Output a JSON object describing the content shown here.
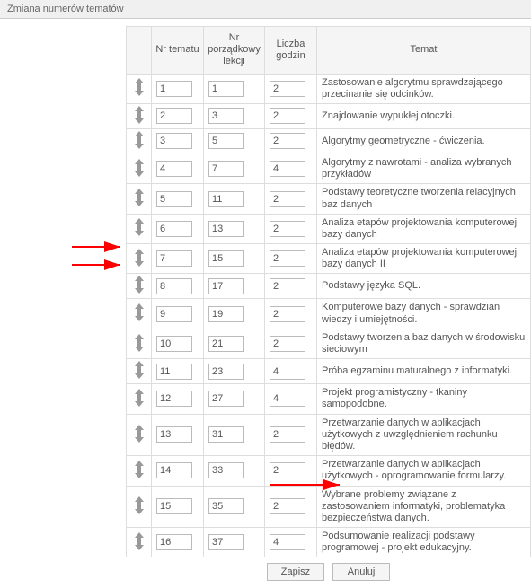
{
  "title": "Zmiana numerów tematów",
  "headers": {
    "nr_tematu": "Nr tematu",
    "nr_lekcji": "Nr porządkowy lekcji",
    "liczba_godzin": "Liczba godzin",
    "temat": "Temat"
  },
  "rows": [
    {
      "nr": "1",
      "lp": "1",
      "lg": "2",
      "topic": "Zastosowanie algorytmu sprawdzającego przecinanie się odcinków."
    },
    {
      "nr": "2",
      "lp": "3",
      "lg": "2",
      "topic": "Znajdowanie wypukłej otoczki."
    },
    {
      "nr": "3",
      "lp": "5",
      "lg": "2",
      "topic": "Algorytmy geometryczne - ćwiczenia."
    },
    {
      "nr": "4",
      "lp": "7",
      "lg": "4",
      "topic": "Algorytmy z nawrotami - analiza wybranych przykładów"
    },
    {
      "nr": "5",
      "lp": "11",
      "lg": "2",
      "topic": "Podstawy teoretyczne tworzenia relacyjnych baz danych"
    },
    {
      "nr": "6",
      "lp": "13",
      "lg": "2",
      "topic": "Analiza etapów projektowania komputerowej bazy danych"
    },
    {
      "nr": "7",
      "lp": "15",
      "lg": "2",
      "topic": "Analiza etapów projektowania komputerowej bazy danych II"
    },
    {
      "nr": "8",
      "lp": "17",
      "lg": "2",
      "topic": "Podstawy języka SQL."
    },
    {
      "nr": "9",
      "lp": "19",
      "lg": "2",
      "topic": "Komputerowe bazy danych - sprawdzian wiedzy i umiejętności."
    },
    {
      "nr": "10",
      "lp": "21",
      "lg": "2",
      "topic": "Podstawy tworzenia baz danych w środowisku sieciowym"
    },
    {
      "nr": "11",
      "lp": "23",
      "lg": "4",
      "topic": "Próba egzaminu maturalnego z informatyki."
    },
    {
      "nr": "12",
      "lp": "27",
      "lg": "4",
      "topic": "Projekt programistyczny - tkaniny samopodobne."
    },
    {
      "nr": "13",
      "lp": "31",
      "lg": "2",
      "topic": "Przetwarzanie danych w aplikacjach użytkowych z uwzględnieniem rachunku błędów."
    },
    {
      "nr": "14",
      "lp": "33",
      "lg": "2",
      "topic": "Przetwarzanie danych w aplikacjach użytkowych - oprogramowanie formularzy."
    },
    {
      "nr": "15",
      "lp": "35",
      "lg": "2",
      "topic": "Wybrane problemy związane z zastosowaniem informatyki, problematyka bezpieczeństwa danych."
    },
    {
      "nr": "16",
      "lp": "37",
      "lg": "4",
      "topic": "Podsumowanie realizacji podstawy programowej - projekt edukacyjny."
    }
  ],
  "buttons": {
    "save": "Zapisz",
    "cancel": "Anuluj"
  }
}
